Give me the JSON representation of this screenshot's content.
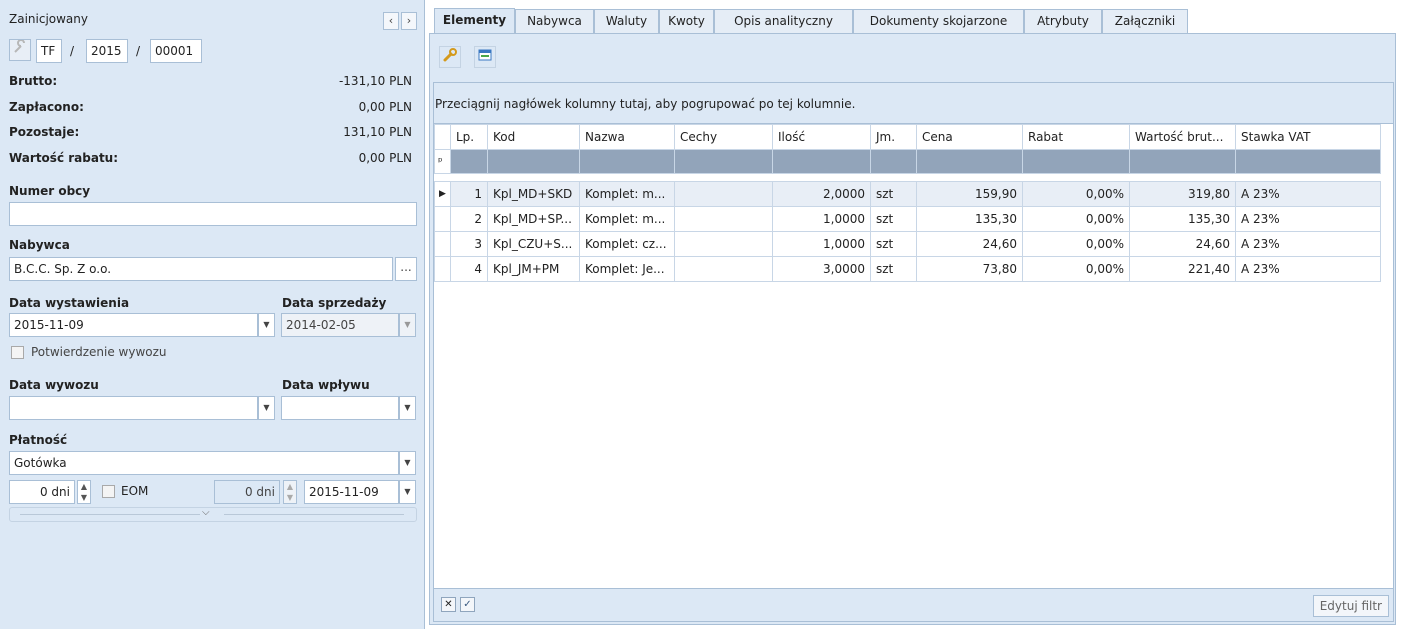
{
  "header": {
    "status": "Zainicjowany",
    "doc_number": {
      "prefix": "TF",
      "year": "2015",
      "number": "00001",
      "sep1": "/",
      "sep2": "/"
    }
  },
  "summary": [
    {
      "label": "Brutto:",
      "value": "-131,10 PLN"
    },
    {
      "label": "Zapłacono:",
      "value": "0,00 PLN"
    },
    {
      "label": "Pozostaje:",
      "value": "131,10 PLN"
    },
    {
      "label": "Wartość rabatu:",
      "value": "0,00 PLN"
    }
  ],
  "numer_obcy": {
    "label": "Numer obcy",
    "value": ""
  },
  "nabywca": {
    "label": "Nabywca",
    "value": "B.C.C. Sp. Z o.o.",
    "button": "..."
  },
  "dates": {
    "wystawienia_label": "Data wystawienia",
    "wystawienia": "2015-11-09",
    "sprzedazy_label": "Data sprzedaży",
    "sprzedazy": "2014-02-05",
    "potwierdzenie_label": "Potwierdzenie wywozu",
    "wywozu_label": "Data wywozu",
    "wywozu": "",
    "wplywu_label": "Data wpływu",
    "wplywu": ""
  },
  "platnosc": {
    "label": "Płatność",
    "value": "Gotówka",
    "dni1": "0 dni",
    "eom_label": "EOM",
    "dni2": "0 dni",
    "termin": "2015-11-09"
  },
  "tabs": [
    "Elementy",
    "Nabywca",
    "Waluty",
    "Kwoty",
    "Opis analityczny",
    "Dokumenty skojarzone",
    "Atrybuty",
    "Załączniki"
  ],
  "grid": {
    "group_hint": "Przeciągnij nagłówek kolumny tutaj, aby pogrupować po tej kolumnie.",
    "columns": [
      "Lp.",
      "Kod",
      "Nazwa",
      "Cechy",
      "Ilość",
      "Jm.",
      "Cena",
      "Rabat",
      "Wartość brut...",
      "Stawka VAT"
    ],
    "rows": [
      [
        "1",
        "Kpl_MD+SKD",
        "Komplet: m...",
        "",
        "2,0000",
        "szt",
        "159,90",
        "0,00%",
        "319,80",
        "A 23%"
      ],
      [
        "2",
        "Kpl_MD+SP...",
        "Komplet: m...",
        "",
        "1,0000",
        "szt",
        "135,30",
        "0,00%",
        "135,30",
        "A 23%"
      ],
      [
        "3",
        "Kpl_CZU+S...",
        "Komplet: cz...",
        "",
        "1,0000",
        "szt",
        "24,60",
        "0,00%",
        "24,60",
        "A 23%"
      ],
      [
        "4",
        "Kpl_JM+PM",
        "Komplet: Je...",
        "",
        "3,0000",
        "szt",
        "73,80",
        "0,00%",
        "221,40",
        "A 23%"
      ]
    ],
    "filter_button": "Edytuj filtr"
  },
  "icons": {
    "wrench": "wrench-icon",
    "nav_prev": "chevron-left-icon",
    "nav_next": "chevron-right-icon",
    "view": "grid-view-icon",
    "filter_clear": "filter-clear-icon",
    "filter_check": "checkmark-icon",
    "pin": "pin-icon",
    "row_pointer": "row-pointer-icon"
  },
  "colors": {
    "panel": "#dce8f5",
    "border": "#a9bfd6",
    "filter_row": "#92a4ba"
  }
}
